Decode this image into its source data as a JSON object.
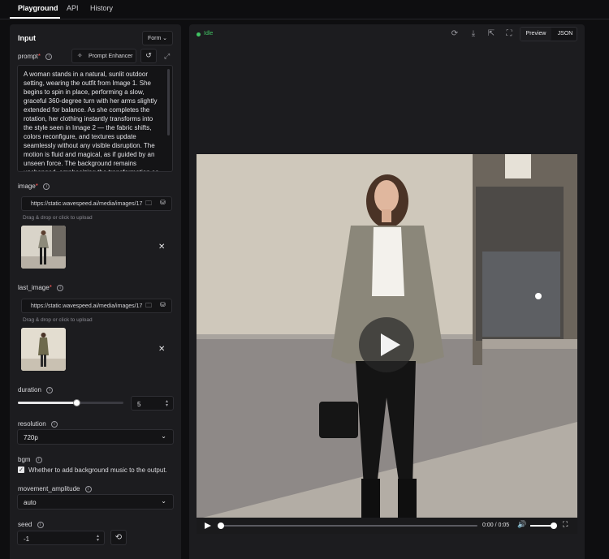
{
  "nav": {
    "tabs": [
      "Playground",
      "API",
      "History"
    ],
    "active": "Playground"
  },
  "input_panel": {
    "title": "Input",
    "mode_select": "Form",
    "prompt": {
      "label": "prompt",
      "required_mark": "*",
      "enhancer_label": "Prompt Enhancer",
      "value": "A woman stands in a natural, sunlit outdoor setting, wearing the outfit from Image 1. She begins to spin in place, performing a slow, graceful 360-degree turn with her arms slightly extended for balance. As she completes the rotation, her clothing instantly transforms into the style seen in Image 2 — the fabric shifts, colors reconfigure, and textures update seamlessly without any visible disruption. The motion is fluid and magical, as if guided by an unseen force. The background remains unchanged, emphasizing the transformation as"
    },
    "image": {
      "label": "image",
      "required_mark": "*",
      "url": "https://static.wavespeed.ai/media/images/17",
      "hint": "Drag & drop or click to upload"
    },
    "last_image": {
      "label": "last_image",
      "required_mark": "*",
      "url": "https://static.wavespeed.ai/media/images/17",
      "hint": "Drag & drop or click to upload"
    },
    "duration": {
      "label": "duration",
      "value": "5",
      "slider_fraction": 0.56
    },
    "resolution": {
      "label": "resolution",
      "value": "720p"
    },
    "bgm": {
      "label": "bgm",
      "checkbox_text": "Whether to add background music to the output.",
      "checked": true
    },
    "movement_amplitude": {
      "label": "movement_amplitude",
      "value": "auto"
    },
    "seed": {
      "label": "seed",
      "value": "-1"
    }
  },
  "output_panel": {
    "status": "Idle",
    "status_color": "#41c463",
    "view_tabs": [
      "Preview",
      "JSON"
    ],
    "tool_icons": [
      "refresh-icon",
      "download-icon",
      "external-link-icon",
      "fullscreen-scan-icon"
    ],
    "video": {
      "time_current": "0:00",
      "time_separator": "/",
      "time_total": "0:05",
      "progress_fraction": 0.0,
      "volume_fraction": 0.95
    }
  }
}
